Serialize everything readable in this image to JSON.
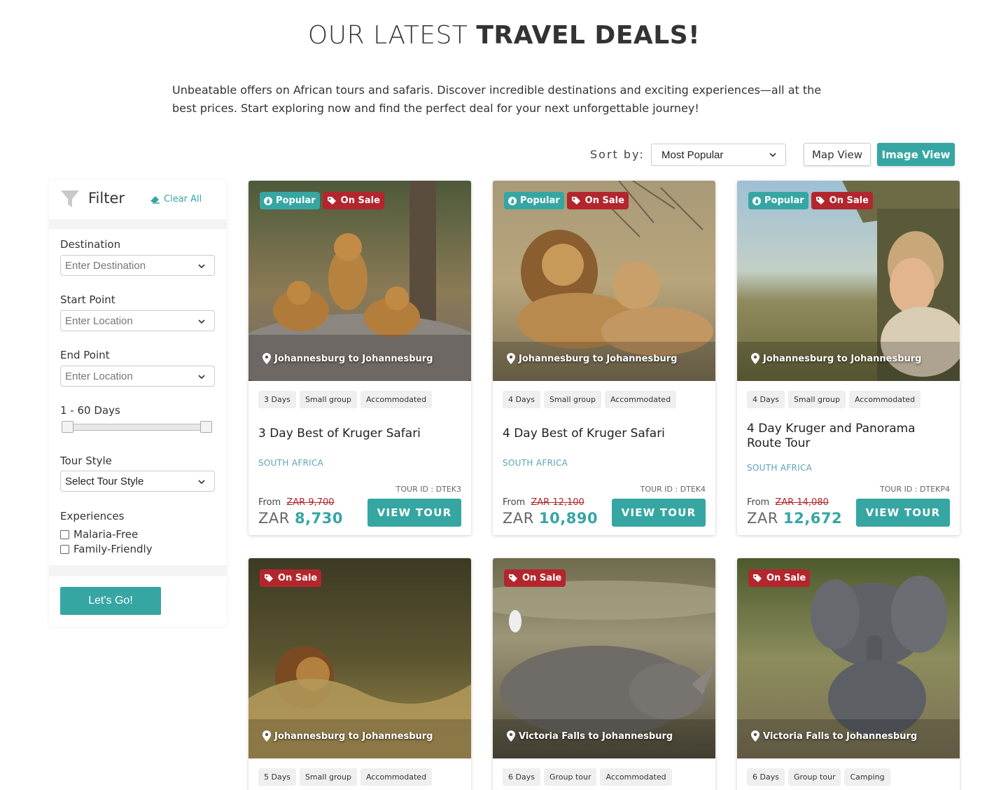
{
  "header": {
    "title_light": "OUR LATEST",
    "title_bold": "TRAVEL DEALS!",
    "intro": "Unbeatable offers on African tours and safaris. Discover incredible destinations and exciting experiences—all at the best prices. Start exploring now and find the perfect deal for your next unforgettable journey!"
  },
  "toolbar": {
    "sort_label": "Sort by:",
    "sort_value": "Most Popular",
    "map_view": "Map View",
    "image_view": "Image View"
  },
  "filter": {
    "title": "Filter",
    "clear_all": "Clear All",
    "destination_label": "Destination",
    "destination_placeholder": "Enter Destination",
    "start_label": "Start Point",
    "start_placeholder": "Enter Location",
    "end_label": "End Point",
    "end_placeholder": "Enter Location",
    "days_label": "1 - 60 Days",
    "style_label": "Tour Style",
    "style_value": "Select Tour Style",
    "experiences_label": "Experiences",
    "experiences": [
      "Malaria-Free",
      "Family-Friendly"
    ],
    "go_button": "Let's Go!"
  },
  "badges": {
    "popular": "Popular",
    "sale": "On Sale"
  },
  "card_labels": {
    "from": "From",
    "view": "VIEW TOUR"
  },
  "cards": [
    {
      "route": "Johannesburg to Johannesburg",
      "popular": true,
      "tags": [
        "3 Days",
        "Small group",
        "Accommodated"
      ],
      "name": "3 Day Best of Kruger Safari",
      "country": "SOUTH AFRICA",
      "tour_id": "TOUR ID : DTEK3",
      "old_price": "ZAR 9,700",
      "currency": "ZAR",
      "price": "8,730"
    },
    {
      "route": "Johannesburg to Johannesburg",
      "popular": true,
      "tags": [
        "4 Days",
        "Small group",
        "Accommodated"
      ],
      "name": "4 Day Best of Kruger Safari",
      "country": "SOUTH AFRICA",
      "tour_id": "TOUR ID : DTEK4",
      "old_price": "ZAR 12,100",
      "currency": "ZAR",
      "price": "10,890"
    },
    {
      "route": "Johannesburg to Johannesburg",
      "popular": true,
      "tags": [
        "4 Days",
        "Small group",
        "Accommodated"
      ],
      "name": "4 Day Kruger and Panorama Route Tour",
      "country": "SOUTH AFRICA",
      "tour_id": "TOUR ID : DTEKP4",
      "old_price": "ZAR 14,080",
      "currency": "ZAR",
      "price": "12,672"
    },
    {
      "route": "Johannesburg to Johannesburg",
      "popular": false,
      "tags": [
        "5 Days",
        "Small group",
        "Accommodated"
      ]
    },
    {
      "route": "Victoria Falls to Johannesburg",
      "popular": false,
      "tags": [
        "6 Days",
        "Group tour",
        "Accommodated"
      ]
    },
    {
      "route": "Victoria Falls to Johannesburg",
      "popular": false,
      "tags": [
        "6 Days",
        "Group tour",
        "Camping"
      ]
    }
  ],
  "colors": {
    "accent": "#36a6a3",
    "sale": "#b3262d",
    "country": "#5aa3b8"
  }
}
